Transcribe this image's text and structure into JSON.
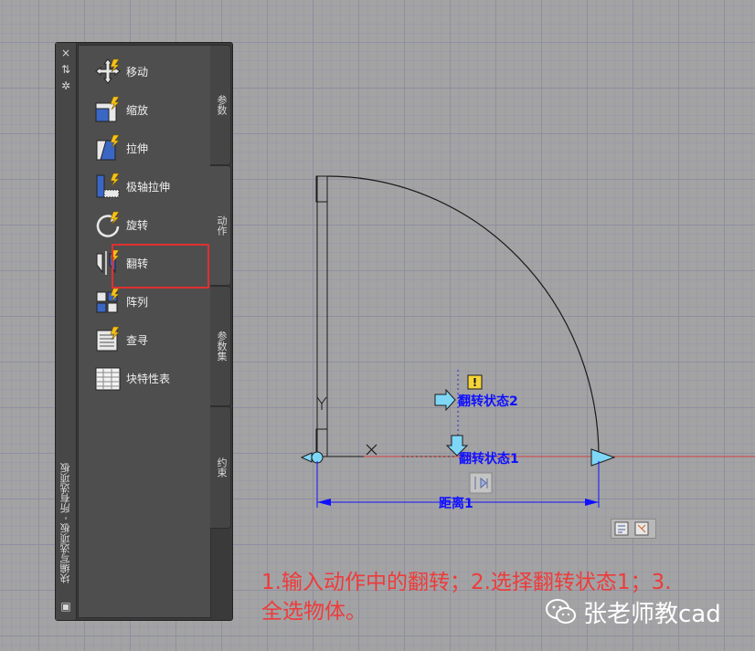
{
  "palette": {
    "title": "块编写选项板 - 所有选项板",
    "tools": [
      {
        "label": "移动",
        "icon": "move-icon"
      },
      {
        "label": "缩放",
        "icon": "scale-icon"
      },
      {
        "label": "拉伸",
        "icon": "stretch-icon"
      },
      {
        "label": "极轴拉伸",
        "icon": "polar-stretch-icon"
      },
      {
        "label": "旋转",
        "icon": "rotate-icon"
      },
      {
        "label": "翻转",
        "icon": "flip-icon"
      },
      {
        "label": "阵列",
        "icon": "array-icon"
      },
      {
        "label": "查寻",
        "icon": "lookup-icon"
      },
      {
        "label": "块特性表",
        "icon": "block-properties-table-icon"
      }
    ],
    "highlighted_tool": "翻转",
    "tabs": [
      {
        "label": "参数",
        "active": false
      },
      {
        "label": "动作",
        "active": true
      },
      {
        "label": "参数集",
        "active": false
      },
      {
        "label": "约束",
        "active": false
      }
    ]
  },
  "drawing": {
    "flip_state_2": "翻转状态2",
    "flip_state_1": "翻转状态1",
    "dimension_label": "距离1",
    "warning_badge": "!",
    "colors": {
      "dim": "#1010ff",
      "arrow": "#7fd7f7",
      "axis": "#d04040",
      "door": "#1a1a1a"
    }
  },
  "annotation": {
    "line1": "1.输入动作中的翻转；2.选择翻转状态1；3.",
    "line2": "全选物体。"
  },
  "watermark": {
    "text": "张老师教cad"
  }
}
